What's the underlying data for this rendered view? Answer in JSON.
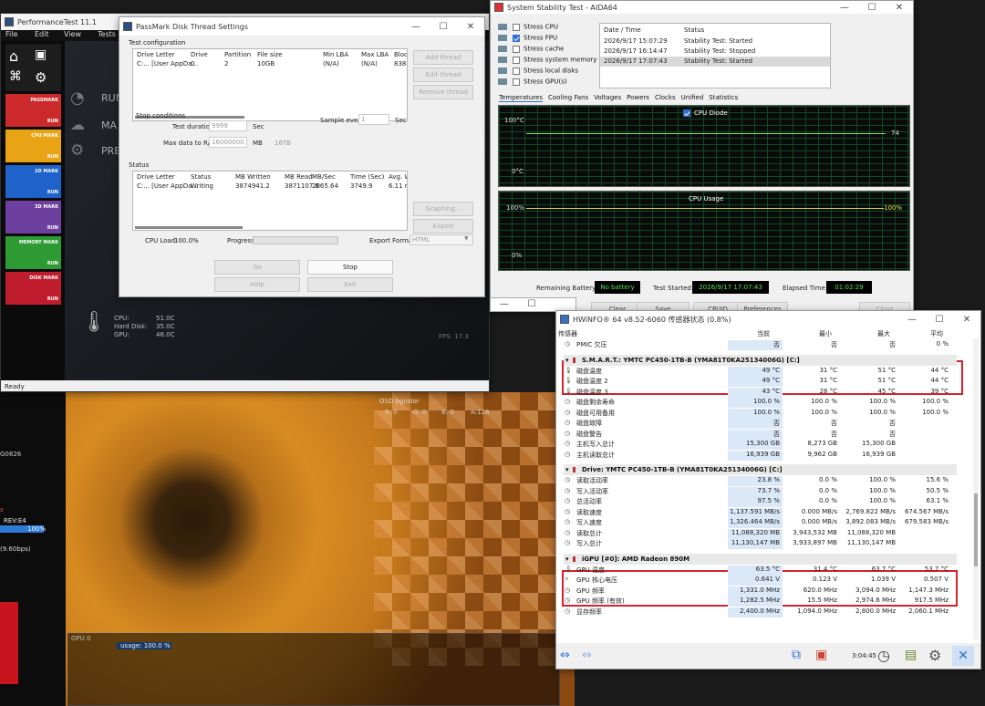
{
  "perftest": {
    "title": "PerformanceTest 11.1",
    "menu": [
      "File",
      "Edit",
      "View",
      "Tests"
    ],
    "tiles": [
      {
        "label": "PASSMARK",
        "run": "RUN",
        "color": "#cc2a2a"
      },
      {
        "label": "CPU MARK",
        "run": "RUN",
        "color": "#e8a414"
      },
      {
        "label": "2D MARK",
        "run": "RUN",
        "color": "#1f62c9"
      },
      {
        "label": "3D MARK",
        "run": "RUN",
        "color": "#6d3f9e"
      },
      {
        "label": "MEMORY MARK",
        "run": "RUN",
        "color": "#2e9a34"
      },
      {
        "label": "DISK MARK",
        "run": "RUN",
        "color": "#bf1c2e"
      }
    ],
    "side_labels": [
      "RUN",
      "MA",
      "PRE"
    ],
    "temps": {
      "cpu_label": "CPU:",
      "cpu": "51.0C",
      "disk_label": "Hard Disk:",
      "disk": "35.0C",
      "gpu_label": "GPU:",
      "gpu": "46.0C"
    },
    "fps": "FPS: 17.3",
    "status": "Ready",
    "footer_left": [
      "G0826",
      "s",
      "REV:E4",
      "100%",
      "(9.60bps)"
    ]
  },
  "disk_thread": {
    "title": "PassMark Disk Thread Settings",
    "test_config": "Test configuration",
    "columns": [
      "Drive Letter",
      "Drive",
      "Partition",
      "File size",
      "Min LBA",
      "Max LBA",
      "Block"
    ],
    "row": [
      "C:... [User AppDa...",
      "0",
      "2",
      "10GB",
      "(N/A)",
      "(N/A)",
      "8388"
    ],
    "add_thread": "Add thread",
    "edit_thread": "Edit thread",
    "remove_thread": "Remove thread",
    "stop_conditions": "Stop conditions",
    "test_duration_label": "Test duration",
    "test_duration": "9999",
    "sec": "Sec",
    "max_data_label": "Max data to R/W",
    "max_data": "16000000",
    "mb": "MB",
    "data_suffix": "16TB",
    "sample_label": "Sample every",
    "sample": "1",
    "sample_unit": "Sec",
    "status_title": "Status",
    "status_columns": [
      "Drive Letter",
      "Status",
      "MB Written",
      "MB Read",
      "MB/Sec",
      "Time (Sec)",
      "Avg. W"
    ],
    "status_row": [
      "C:... [User AppDa...",
      "Writing",
      "3874941.2",
      "3871107.8",
      "2065.64",
      "3749.9",
      "6.11 m"
    ],
    "graphing": "Graphing...",
    "export": "Export",
    "cpu_load_label": "CPU Load",
    "cpu_load": "100.0%",
    "progress_label": "Progress",
    "export_format_label": "Export Format",
    "export_format": "HTML",
    "go": "Go",
    "stop": "Stop",
    "help": "Help",
    "exit": "Exit"
  },
  "aida": {
    "title": "System Stability Test - AIDA64",
    "stress": [
      {
        "label": "Stress CPU",
        "checked": false
      },
      {
        "label": "Stress FPU",
        "checked": true
      },
      {
        "label": "Stress cache",
        "checked": false
      },
      {
        "label": "Stress system memory",
        "checked": false
      },
      {
        "label": "Stress local disks",
        "checked": false
      },
      {
        "label": "Stress GPU(s)",
        "checked": false
      }
    ],
    "log_columns": [
      "Date / Time",
      "Status"
    ],
    "log": [
      [
        "2026/9/17 15:07:29",
        "Stability Test: Started"
      ],
      [
        "2026/9/17 16:14:47",
        "Stability Test: Stopped"
      ],
      [
        "2026/9/17 17:07:43",
        "Stability Test: Started"
      ]
    ],
    "tabs": [
      "Temperatures",
      "Cooling Fans",
      "Voltages",
      "Powers",
      "Clocks",
      "Unified",
      "Statistics"
    ],
    "temp_legend": "CPU Diode",
    "temp_top": "100°C",
    "temp_bottom": "0°C",
    "temp_value": "74",
    "usage_title": "CPU Usage",
    "usage_top": "100%",
    "usage_bottom": "0%",
    "usage_value": "100%",
    "battery_label": "Remaining Battery:",
    "battery": "No battery",
    "started_label": "Test Started:",
    "started": "2026/9/17 17:07:43",
    "elapsed_label": "Elapsed Time:",
    "elapsed": "01:02:29",
    "buttons": [
      "Clear",
      "Save",
      "CPUID",
      "Preferences",
      "Close"
    ]
  },
  "hwinfo": {
    "title": "HWiNFO® 64 v8.52-6060 传感器状态 (0.8%)",
    "columns": [
      "传感器",
      "当前",
      "最小",
      "最大",
      "平均"
    ],
    "pmic": [
      "PMIC 欠压",
      "否",
      "否",
      "否",
      "0 %"
    ],
    "smart_title": "S.M.A.R.T.: YMTC PC450-1TB-B (YMA81T0KA25134006G) [C:]",
    "smart_rows": [
      [
        "磁盘温度",
        "49 °C",
        "31 °C",
        "51 °C",
        "44 °C"
      ],
      [
        "磁盘温度 2",
        "49 °C",
        "31 °C",
        "51 °C",
        "44 °C"
      ],
      [
        "磁盘温度 3",
        "43 °C",
        "28 °C",
        "45 °C",
        "39 °C"
      ],
      [
        "磁盘剩余寿命",
        "100.0 %",
        "100.0 %",
        "100.0 %",
        "100.0 %"
      ],
      [
        "磁盘可用备用",
        "100.0 %",
        "100.0 %",
        "100.0 %",
        "100.0 %"
      ],
      [
        "磁盘故障",
        "否",
        "否",
        "否",
        ""
      ],
      [
        "磁盘警告",
        "否",
        "否",
        "否",
        ""
      ],
      [
        "主机写入总计",
        "15,300 GB",
        "8,273 GB",
        "15,300 GB",
        ""
      ],
      [
        "主机读取总计",
        "16,939 GB",
        "9,962 GB",
        "16,939 GB",
        ""
      ]
    ],
    "drive_title": "Drive: YMTC PC450-1TB-B (YMA81T0KA25134006G) [C:]",
    "drive_rows": [
      [
        "读取活动率",
        "23.8 %",
        "0.0 %",
        "100.0 %",
        "15.6 %"
      ],
      [
        "写入活动率",
        "73.7 %",
        "0.0 %",
        "100.0 %",
        "50.5 %"
      ],
      [
        "总活动率",
        "97.5 %",
        "0.0 %",
        "100.0 %",
        "63.1 %"
      ],
      [
        "读取速度",
        "1,137.591 MB/s",
        "0.000 MB/s",
        "2,769.822 MB/s",
        "674.567 MB/s"
      ],
      [
        "写入速度",
        "1,326.464 MB/s",
        "0.000 MB/s",
        "3,892.083 MB/s",
        "679.583 MB/s"
      ],
      [
        "读取总计",
        "11,088,320 MB",
        "3,943,532 MB",
        "11,088,320 MB",
        ""
      ],
      [
        "写入总计",
        "11,130,147 MB",
        "3,933,897 MB",
        "11,130,147 MB",
        ""
      ]
    ],
    "gpu_title": "iGPU [#0]: AMD Radeon 890M",
    "gpu_rows": [
      [
        "GPU 温度",
        "63.5 °C",
        "31.4 °C",
        "63.7 °C",
        "53.7 °C"
      ],
      [
        "GPU 核心电压",
        "0.641 V",
        "0.123 V",
        "1.039 V",
        "0.507 V"
      ],
      [
        "GPU 频率",
        "1,331.0 MHz",
        "620.0 MHz",
        "3,094.0 MHz",
        "1,147.3 MHz"
      ],
      [
        "GPU 频率 (有效)",
        "1,282.5 MHz",
        "15.5 MHz",
        "2,974.6 MHz",
        "917.5 MHz"
      ],
      [
        "显存频率",
        "2,400.0 MHz",
        "1,094.0 MHz",
        "2,800.0 MHz",
        "2,060.1 MHz"
      ]
    ],
    "clock": "3:04:45"
  },
  "osd": {
    "title": "OSD bgcolor",
    "r": "R: 0",
    "g": "G: 0",
    "b": "B: 0",
    "a": "A:128",
    "gpu_label": "GPU 0",
    "usage": "usage: 100.0 %"
  }
}
